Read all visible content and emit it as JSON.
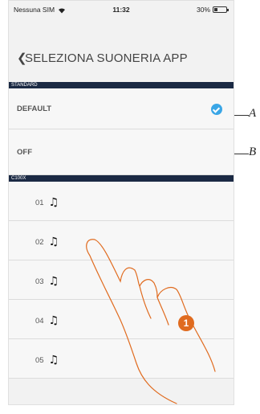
{
  "status_bar": {
    "carrier": "Nessuna SIM",
    "time": "11:32",
    "battery": "30%",
    "battery_level": 0.3
  },
  "header": {
    "back_glyph": "❮",
    "title": "SELEZIONA SUONERIA APP"
  },
  "sections": {
    "standard": "STANDARD",
    "c100x": "C100X"
  },
  "standard_rows": {
    "default": "DEFAULT",
    "off": "OFF"
  },
  "ringtones": [
    "01",
    "02",
    "03",
    "04",
    "05"
  ],
  "ringtone_icon": "music-note-icon",
  "callouts": {
    "a": "A",
    "b": "B"
  },
  "step_badge": "1",
  "colors": {
    "accent": "#3aa6e6",
    "section_bar": "#1b2a44",
    "step_badge": "#e06b1f"
  }
}
